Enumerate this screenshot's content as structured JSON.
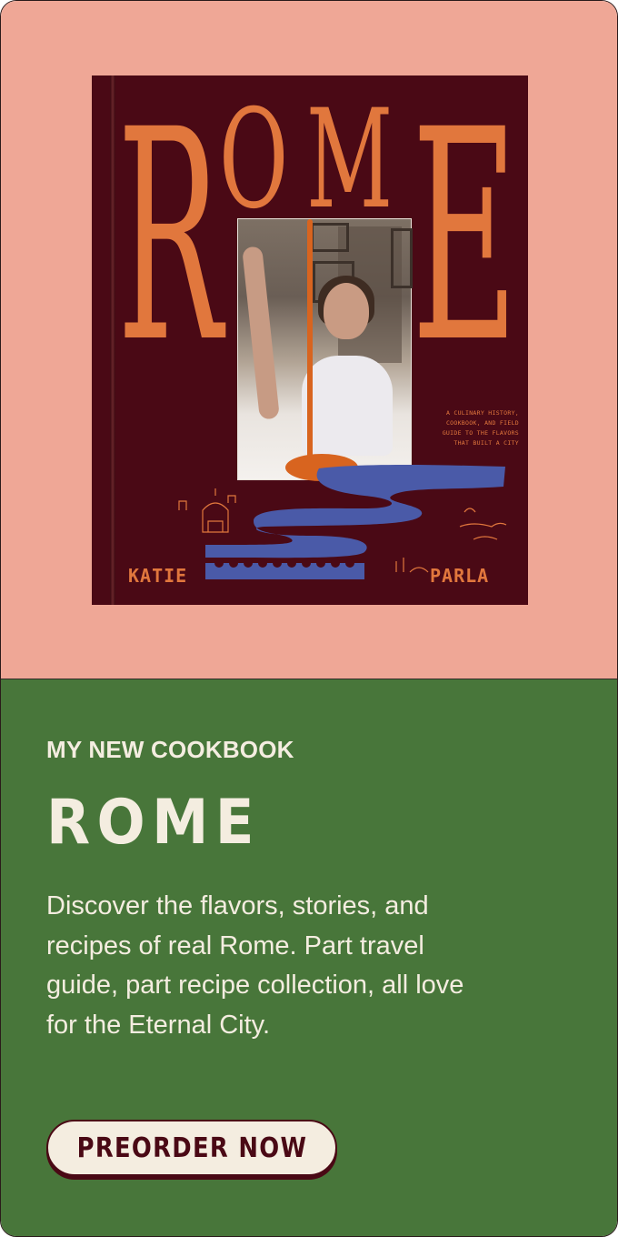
{
  "cover": {
    "title_letters": [
      "R",
      "O",
      "M",
      "E"
    ],
    "tagline": [
      "A CULINARY HISTORY,",
      "COOKBOOK, AND FIELD",
      "GUIDE TO THE FLAVORS",
      "THAT BUILT A CITY"
    ],
    "author_first": "KATIE",
    "author_last": "PARLA",
    "colors": {
      "background": "#4a0915",
      "lettering": "#e1773d",
      "river": "#4a5aa8"
    }
  },
  "promo": {
    "eyebrow": "MY NEW COOKBOOK",
    "heading": "ROME",
    "description": "Discover the flavors, stories, and recipes of real Rome. Part travel guide, part recipe collection, all love for the Eternal City.",
    "button_label": "PREORDER NOW"
  },
  "colors": {
    "top_panel": "#efa796",
    "bottom_panel": "#48763a",
    "text_light": "#f4ede0",
    "button_text": "#4a0915"
  }
}
